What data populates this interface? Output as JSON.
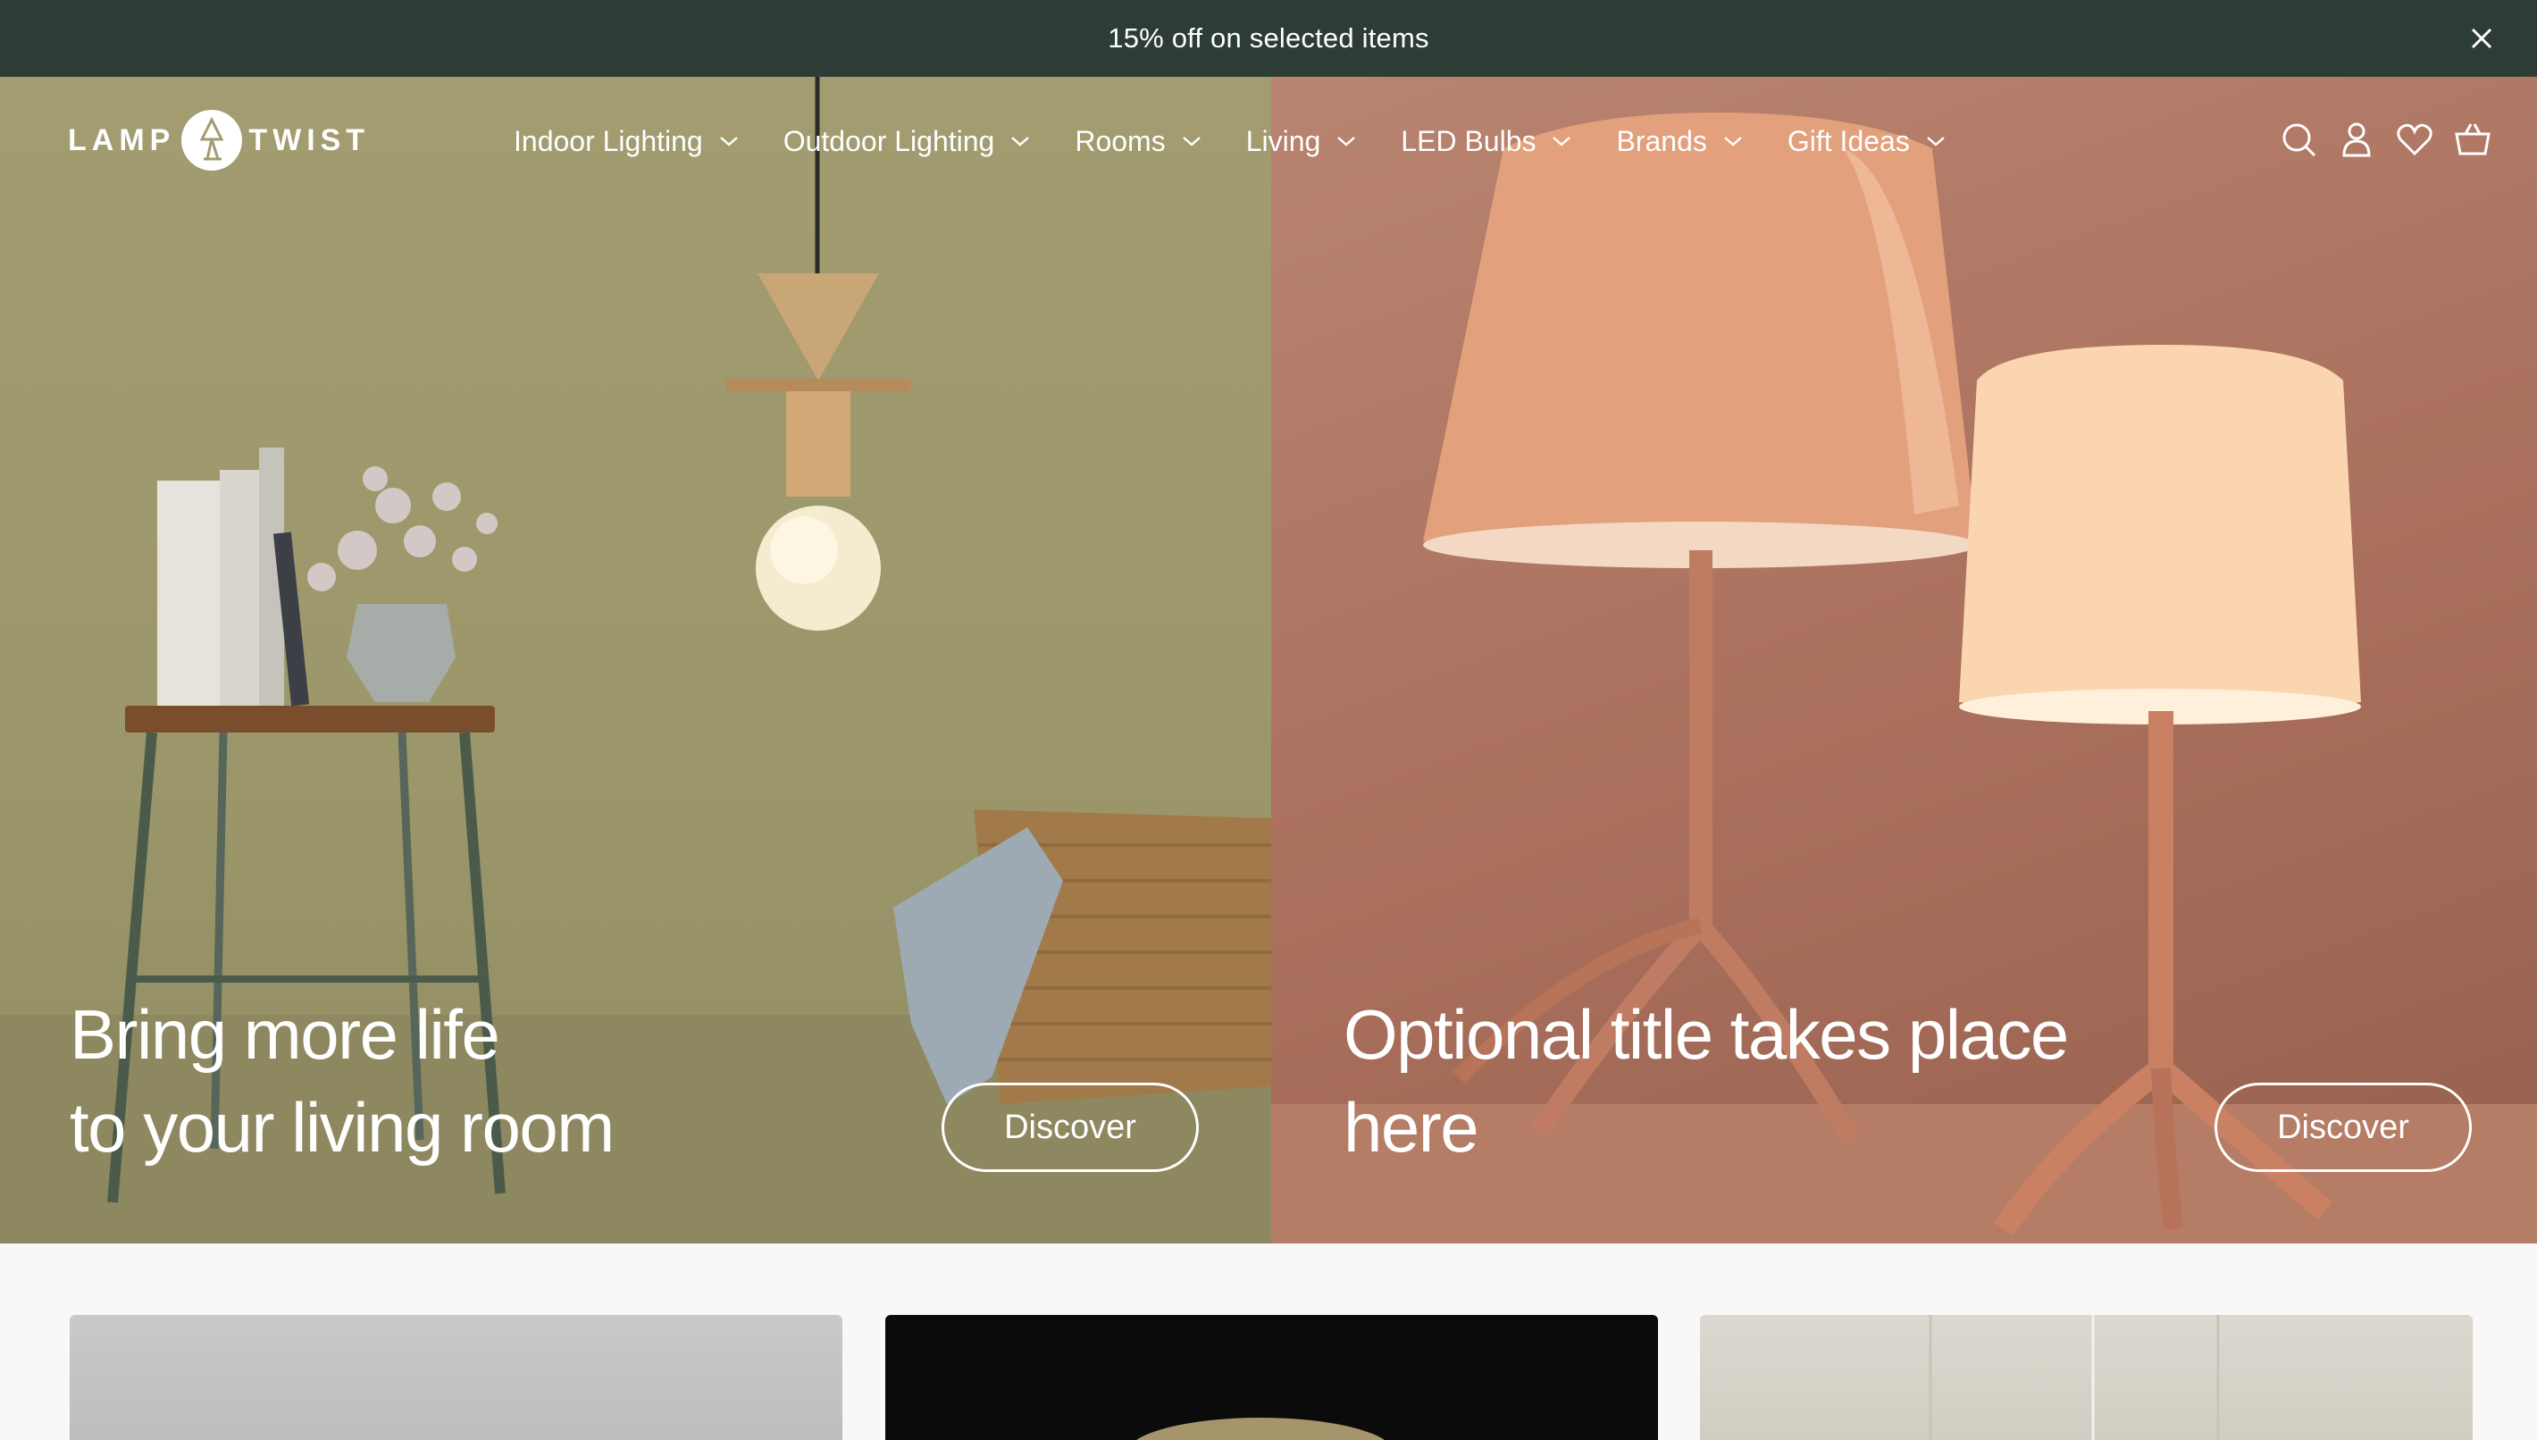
{
  "announcement": {
    "text": "15% off on selected items",
    "close_icon": "close-icon"
  },
  "brand": {
    "word_left": "LAMP",
    "word_right": "TWIST"
  },
  "nav": {
    "items": [
      {
        "label": "Indoor Lighting"
      },
      {
        "label": "Outdoor Lighting"
      },
      {
        "label": "Rooms"
      },
      {
        "label": "Living"
      },
      {
        "label": "LED Bulbs"
      },
      {
        "label": "Brands"
      },
      {
        "label": "Gift Ideas"
      }
    ],
    "tools": [
      "search-icon",
      "account-icon",
      "wishlist-icon",
      "cart-icon"
    ]
  },
  "hero": {
    "left": {
      "title_line1": "Bring more life",
      "title_line2": "to your living room",
      "cta": "Discover"
    },
    "right": {
      "title_line1": "Optional title takes place",
      "title_line2": "here",
      "cta": "Discover"
    }
  },
  "colors": {
    "announcement_bg": "#2d3d36",
    "left_panel": "#a29c70",
    "right_panel": "#b07865",
    "text_light": "#ffffff"
  }
}
